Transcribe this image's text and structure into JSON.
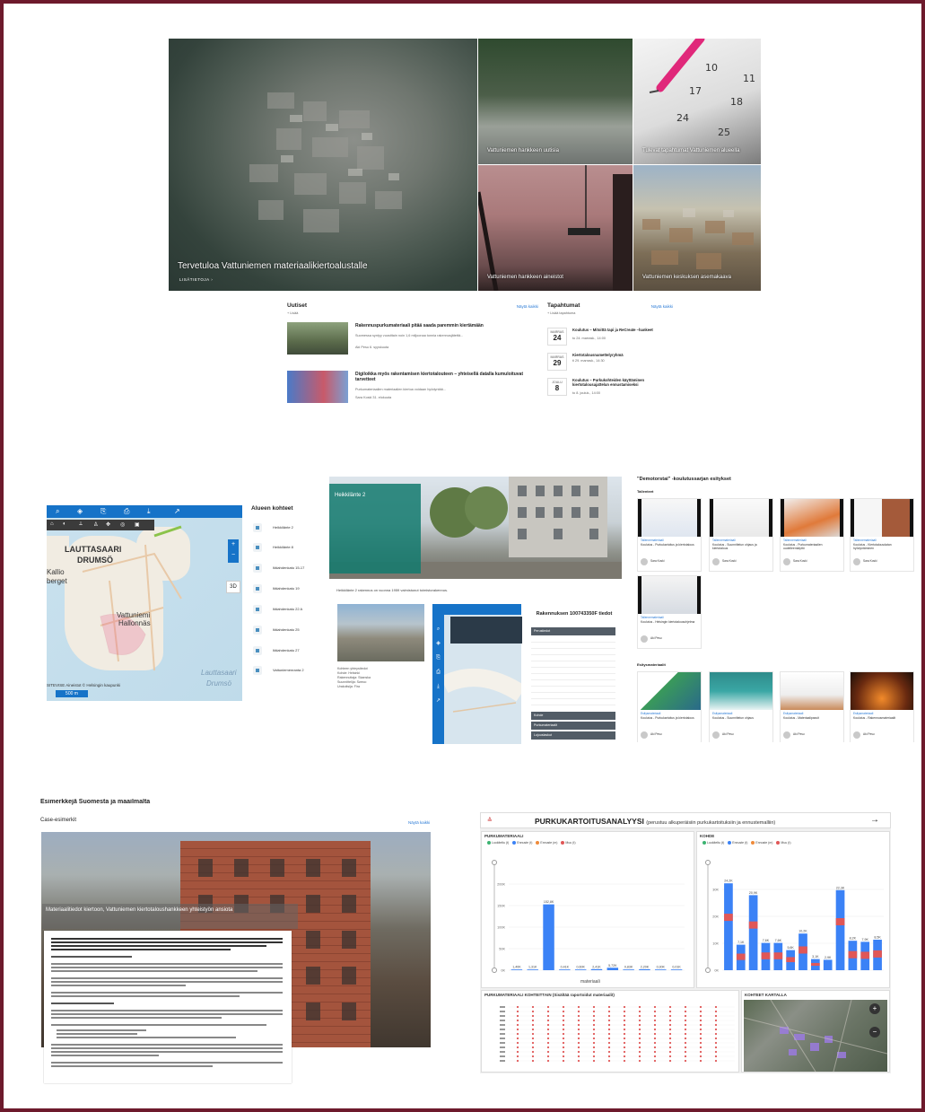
{
  "hero": {
    "main_caption": "Tervetuloa Vattuniemen materiaalikiertoalustalle",
    "main_more": "LISÄTIETOJA",
    "tile_news": "Vattuniemen hankkeen uutisia",
    "tile_events": "Tulevat tapahtumat Vattuniemen alueella",
    "tile_materials": "Vattuniemen hankkeen aineistot",
    "tile_plan": "Vattuniemen keskuksen asemakaava",
    "calendar_numbers": [
      "10",
      "11",
      "17",
      "18",
      "24",
      "25"
    ]
  },
  "news": {
    "title": "Uutiset",
    "see_all": "Näytä kaikki",
    "add": "+ Lisää",
    "items": [
      {
        "title": "Rakennuspurkumateriaali pitää saada paremmin kiertämään",
        "desc": "Suomessa syntyy vuosittain noin 1,6 miljoonaa tonnia rakennusjätettä...",
        "meta": "Aki Pesu  6. syyskuuta"
      },
      {
        "title": "Digiloikka myös rakentamisen kiertotalouteen – yhteisellä datalla kumuloituvat tarvetteet",
        "desc": "Purkumateriaalien materiaalien kiertoa voidaan hyödyntää...",
        "meta": "Sara Koski  31. elokuuta"
      }
    ]
  },
  "events": {
    "title": "Tapahtumat",
    "see_all": "Näytä kaikki",
    "add": "+ Lisää tapahtuma",
    "items": [
      {
        "month": "MARRAS",
        "day": "24",
        "title": "Koulutus – Mitoittä tapi ja ReCreate –hankeet",
        "time": "to 24. marrask., 14:00"
      },
      {
        "month": "MARRAS",
        "day": "29",
        "title": "Kiertotalousnamettelyryhmä",
        "time": "ti 29. marrask., 14:30"
      },
      {
        "month": "JOULU",
        "day": "8",
        "title": "Koulutus – Purkukohteiden käyttäminen kiertotalousajattelun ennustamiseksi",
        "time": "to 8. jouluk., 14:00"
      }
    ]
  },
  "map": {
    "labels": [
      "LAUTTASAARI",
      "DRUMSÖ",
      "Vattuniemi",
      "Hallonnäs",
      "Lauttasaari",
      "Drumsö",
      "Kallio",
      "berget"
    ],
    "attribution": "SITEVISE Aineistot © Helsingin kaupunki",
    "scale": "500 m",
    "btn_3d": "3D"
  },
  "areas": {
    "title": "Alueen kohteet",
    "items": [
      "Heikkilänte 2",
      "Heikkilänte 8",
      "Itälahdenkatu 15-17",
      "Itälahdenkatu 19",
      "Itälahdenkatu 22 A",
      "Itälahdenkatu 25",
      "Itälahdenkatu 27",
      "Vattuniemenranta 2"
    ]
  },
  "building": {
    "panel_title": "Heikkilänte 2",
    "desc": "Heikkilänte 2 rakennus on vuonna 1959 valmistunut toimistorakennus.",
    "list_title": "Kohteen yhteystiedot",
    "list": [
      "Kohde: Helsinki",
      "Rakennuttaja: Skanska",
      "Suunnittelija: Sweco",
      "Urakoitsija: Fira"
    ],
    "info_title": "Rakennuksen 100743350F tiedot",
    "info_head": "Perustiedot",
    "info_head2": "Kohde",
    "info_head3": "Purkumateriaalit",
    "info_head4": "Lujuuslaskut"
  },
  "videos": {
    "title": "\"Demotorstai\" -koulutussarjan esitykset",
    "sub1": "Tallenteet",
    "sub2": "Esitysmateriaalit",
    "cards": [
      {
        "cat": "Tallennemateriaali",
        "title": "Koulutus - Purkukartoitus ja kiertotalous",
        "author": "Sara Koski"
      },
      {
        "cat": "Tallennemateriaali",
        "title": "Koulutus - Suunnittelun ohjaus ja kiertotalous",
        "author": "Sara Koski"
      },
      {
        "cat": "Tallennemateriaali",
        "title": "Koulutus - Purkumateriaalien uudelleenkäyttö",
        "author": "Sara Koski"
      },
      {
        "cat": "Tallennemateriaali",
        "title": "Koulutus - Kiertotalousdatan hyödyntäminen",
        "author": "Sara Koski"
      },
      {
        "cat": "Tallennemateriaali",
        "title": "Koulutus - Helsingin kiertotalousohjelma",
        "author": "Aki Pesu"
      },
      {
        "cat": "Esitysmateriaali",
        "title": "Koulutus - Purkukartoitus ja kiertotalous",
        "author": "Aki Pesu"
      },
      {
        "cat": "Esitysmateriaali",
        "title": "Koulutus - Suunnittelun ohjaus",
        "author": "Aki Pesu"
      },
      {
        "cat": "Esitysmateriaali",
        "title": "Koulutus - Materiaalipassit",
        "author": "Aki Pesu"
      },
      {
        "cat": "Esitysmateriaali",
        "title": "Koulutus - Rakennusmateriaalit",
        "author": "Aki Pesu"
      }
    ]
  },
  "cases": {
    "title": "Esimerkkejä Suomesta ja maailmalta",
    "subtitle": "Case-esimerkit",
    "see_all": "Näytä kaikki",
    "banner": "Materiaalitiedot kiertoon, Vattuniemen kiertotaloushankkeen yhteistyön ansiota"
  },
  "dashboard": {
    "logo": "≙",
    "title": "PURKUKARTOITUSANALYYSI",
    "title_sub": "(perustuu alkuperäisiin purkukartoituksiin ja ennustemalliin)",
    "arrow": "→",
    "p1_title": "PURKUMATERIAALI",
    "p1_legend": [
      "Luokiteltu (t)",
      "Ennuste (t)",
      "Ennuste (m)",
      "Muu (t)"
    ],
    "p1_xlabel": "materiaali",
    "p2_title": "KOHDE",
    "p3_title": "PURKUMATERIAALI KOHTEITTAIN (Sisältää raportoidut materiaalit)",
    "p4_title": "KOHTEET KARTALLA",
    "colors": {
      "blue": "#3b82f6",
      "red": "#e05757",
      "orange": "#ef8b3b",
      "green": "#3cb371"
    }
  },
  "chart_data": [
    {
      "type": "bar",
      "title": "PURKUMATERIAALI",
      "xlabel": "materiaali",
      "ylabel": "",
      "ylim": [
        0,
        250
      ],
      "y_ticks": [
        "0K",
        "50K",
        "100K",
        "150K",
        "200K"
      ],
      "series": [
        {
          "name": "Ennuste (t)",
          "values": [
            1.4,
            1.3,
            152.8,
            0.4,
            0.6,
            2.4,
            5.7,
            0.8,
            2.2,
            0.3,
            0.0
          ]
        }
      ],
      "value_labels": [
        "1,40K",
        "1,31K",
        "152,8K",
        "0,41K",
        "0,60K",
        "2,41K",
        "5,72K",
        "0,83K",
        "2,20K",
        "0,30K",
        "0,01K"
      ]
    },
    {
      "type": "bar",
      "title": "KOHDE",
      "ylim": [
        0,
        30
      ],
      "y_ticks": [
        "0K",
        "10K",
        "20K",
        "30K"
      ],
      "series": [
        {
          "name": "Ennuste (t)",
          "values": [
            24.2,
            7.1,
            20.9,
            7.6,
            7.6,
            5.6,
            10.2,
            3.1,
            2.9,
            22.3,
            8.2,
            7.9,
            8.5
          ]
        }
      ],
      "value_labels": [
        "24,2K",
        "7,1K",
        "20,9K",
        "7,6K",
        "7,6K",
        "5,6K",
        "10,2K",
        "3,1K",
        "2,9K",
        "22,3K",
        "8,2K",
        "7,9K",
        "8,5K"
      ]
    }
  ]
}
